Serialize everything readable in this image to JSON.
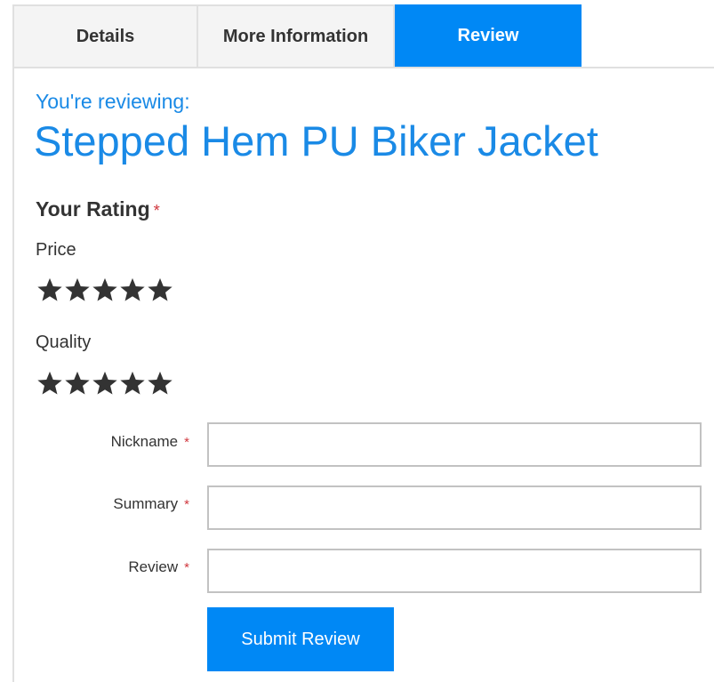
{
  "tabs": [
    {
      "label": "Details",
      "active": false
    },
    {
      "label": "More Information",
      "active": false
    },
    {
      "label": "Review",
      "active": true
    }
  ],
  "colors": {
    "accent": "#0088f5",
    "title_blue": "#1a8ae6",
    "required": "#d0383f",
    "text": "#333333",
    "border": "#c2c2c2"
  },
  "review": {
    "reviewing_label": "You're reviewing:",
    "product_name": "Stepped Hem PU Biker Jacket",
    "rating_heading": "Your Rating",
    "required_mark": "*",
    "ratings": [
      {
        "label": "Price",
        "stars_total": 5,
        "stars_selected": 0
      },
      {
        "label": "Quality",
        "stars_total": 5,
        "stars_selected": 0
      }
    ],
    "fields": [
      {
        "label": "Nickname",
        "value": "",
        "placeholder": ""
      },
      {
        "label": "Summary",
        "value": "",
        "placeholder": ""
      },
      {
        "label": "Review",
        "value": "",
        "placeholder": ""
      }
    ],
    "submit_label": "Submit Review"
  },
  "icons": {
    "star": "star-icon"
  }
}
